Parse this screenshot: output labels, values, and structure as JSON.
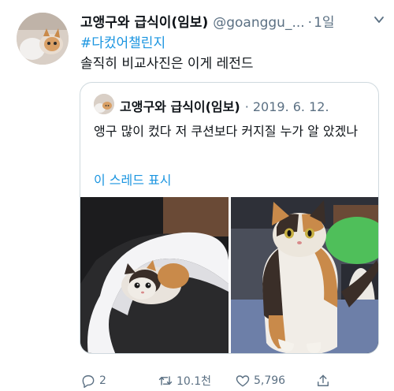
{
  "tweet": {
    "author_name": "고앵구와 급식이(임보)",
    "handle": "@goanggu_...",
    "separator": "·",
    "time": "1일",
    "hashtag": "#다컸어챌린지",
    "text": "솔직히 비교사진은 이게 레전드"
  },
  "quoted": {
    "author_name": "고앵구와 급식이(임보)",
    "meta": "· 2019. 6. 12.",
    "text": "앵구 많이 컸다 저 쿠션보다 커지질 누가 알 았겠나",
    "thread_link": "이 스레드 표시"
  },
  "actions": {
    "replies": "2",
    "retweets": "10.1천",
    "likes": "5,796"
  },
  "colors": {
    "link": "#1b95e0",
    "secondary_text": "#5b7083",
    "border": "#cfd9de"
  }
}
